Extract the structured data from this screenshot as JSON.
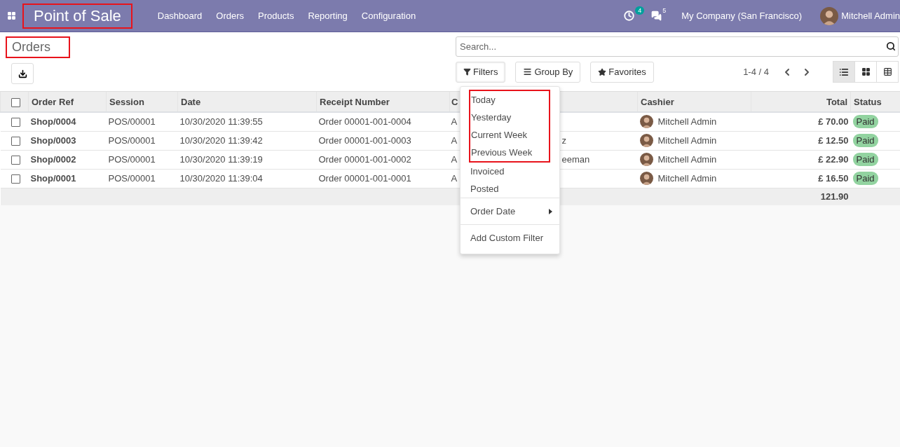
{
  "navbar": {
    "app_title": {
      "text": "Point of Sale",
      "highlighted": true
    },
    "menu": [
      "Dashboard",
      "Orders",
      "Products",
      "Reporting",
      "Configuration"
    ],
    "activity_count": "4",
    "message_count": "5",
    "company": "My Company (San Francisco)",
    "user": "Mitchell Admin"
  },
  "breadcrumb": {
    "text": "Orders",
    "highlighted": true
  },
  "search": {
    "placeholder": "Search..."
  },
  "search_buttons": [
    {
      "kind": "filter",
      "label": "Filters"
    },
    {
      "kind": "group",
      "label": "Group By"
    },
    {
      "kind": "favorites",
      "label": "Favorites"
    }
  ],
  "pager": "1-4 / 4",
  "views": [
    {
      "kind": "list",
      "selected": true
    },
    {
      "kind": "kanban",
      "selected": false
    },
    {
      "kind": "pivot",
      "selected": false
    }
  ],
  "table": {
    "select_all_checked": false,
    "columns": [
      "Order Ref",
      "Session",
      "Date",
      "Receipt Number",
      "C",
      "Cashier",
      "Total",
      "Status"
    ],
    "rows": [
      {
        "checked": false,
        "order_ref": "Shop/0004",
        "session": "POS/00001",
        "date": "10/30/2020 11:39:55",
        "receipt": "Order 00001-001-0004",
        "column_5": {
          "start": "A"
        },
        "cashier": "Mitchell Admin",
        "total": "£ 70.00",
        "status": "Paid"
      },
      {
        "checked": false,
        "order_ref": "Shop/0003",
        "session": "POS/00001",
        "date": "10/30/2020 11:39:42",
        "receipt": "Order 00001-001-0003",
        "column_5": {
          "start": "A",
          "end": "z"
        },
        "cashier": "Mitchell Admin",
        "total": "£ 12.50",
        "status": "Paid"
      },
      {
        "checked": false,
        "order_ref": "Shop/0002",
        "session": "POS/00001",
        "date": "10/30/2020 11:39:19",
        "receipt": "Order 00001-001-0002",
        "column_5": {
          "start": "A",
          "end": "eeman"
        },
        "cashier": "Mitchell Admin",
        "total": "£ 22.90",
        "status": "Paid"
      },
      {
        "checked": false,
        "order_ref": "Shop/0001",
        "session": "POS/00001",
        "date": "10/30/2020 11:39:04",
        "receipt": "Order 00001-001-0001",
        "column_5": {
          "start": "A"
        },
        "cashier": "Mitchell Admin",
        "total": "£ 16.50",
        "status": "Paid"
      }
    ],
    "footer_total": "121.90"
  },
  "filter_menu": {
    "sections": [
      {
        "kind": "highlight",
        "items": [
          {
            "label": "Today",
            "submenu": false
          },
          {
            "label": "Yesterday",
            "submenu": false
          },
          {
            "label": "Current Week",
            "submenu": false
          },
          {
            "label": "Previous Week",
            "submenu": false
          }
        ]
      },
      {
        "kind": "plain",
        "items": [
          {
            "label": "Invoiced",
            "submenu": false
          },
          {
            "label": "Posted",
            "submenu": false
          }
        ]
      },
      {
        "kind": "divided",
        "items": [
          {
            "label": "Order Date",
            "submenu": true
          }
        ]
      },
      {
        "kind": "divided",
        "items": [
          {
            "label": "Add Custom Filter",
            "submenu": false
          }
        ]
      }
    ]
  }
}
